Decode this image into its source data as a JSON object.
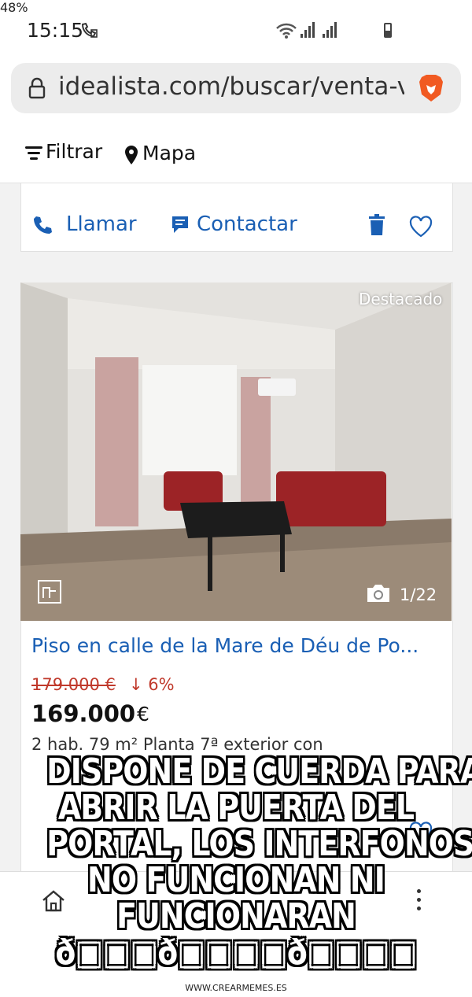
{
  "status_bar": {
    "time": "15:15",
    "battery": "48%"
  },
  "browser": {
    "url": "idealista.com/buscar/venta-v"
  },
  "toolbar": {
    "filter_label": "Filtrar",
    "map_label": "Mapa"
  },
  "actions": {
    "call_label": "Llamar",
    "contact_label": "Contactar"
  },
  "listing": {
    "badge": "Destacado",
    "photo_counter": "1/22",
    "title": "Piso en calle de la Mare de Déu de Po...",
    "old_price": "179.000 €",
    "drop": "↓ 6%",
    "price": "169.000",
    "currency": "€",
    "details": "2 hab.  79 m²  Planta 7ª exterior con"
  },
  "meme": {
    "lines": [
      "DISPONE DE CUERDA PARA",
      "ABRIR LA PUERTA DEL",
      "PORTAL, LOS INTERFONOS",
      "NO FUNCIONAN NI",
      "FUNCIONARAN",
      "ð□□□ð□□□□ð□□□□"
    ],
    "watermark": "WWW.CREARMEMES.ES"
  }
}
